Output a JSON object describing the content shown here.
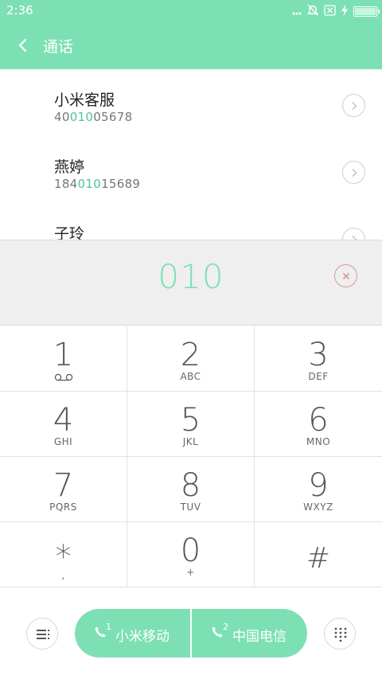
{
  "status_bar": {
    "time": "2:36",
    "icons": [
      "more-dots-icon",
      "mute-bell-icon",
      "sim-off-icon",
      "charging-icon",
      "battery-icon"
    ]
  },
  "app_bar": {
    "title": "通话",
    "back_icon": "chevron-left-icon"
  },
  "contacts": [
    {
      "name": "小米客服",
      "number_pre": "40",
      "number_match": "010",
      "number_post": "05678"
    },
    {
      "name": "燕婷",
      "number_pre": "184",
      "number_match": "010",
      "number_post": "15689"
    },
    {
      "name": "子玲",
      "number_pre": "",
      "number_match": "",
      "number_post": ""
    }
  ],
  "dial_input": {
    "value": "010",
    "clear_icon": "clear-circle-icon"
  },
  "keypad": [
    {
      "digit": "1",
      "letters": ""
    },
    {
      "digit": "2",
      "letters": "ABC"
    },
    {
      "digit": "3",
      "letters": "DEF"
    },
    {
      "digit": "4",
      "letters": "GHI"
    },
    {
      "digit": "5",
      "letters": "JKL"
    },
    {
      "digit": "6",
      "letters": "MNO"
    },
    {
      "digit": "7",
      "letters": "PQRS"
    },
    {
      "digit": "8",
      "letters": "TUV"
    },
    {
      "digit": "9",
      "letters": "WXYZ"
    },
    {
      "digit": "*",
      "letters": ","
    },
    {
      "digit": "0",
      "letters": "+"
    },
    {
      "digit": "#",
      "letters": ""
    }
  ],
  "bottom_bar": {
    "menu_icon": "menu-icon",
    "dialpad_icon": "dialpad-grid-icon",
    "sim1": {
      "index": "1",
      "carrier": "小米移动"
    },
    "sim2": {
      "index": "2",
      "carrier": "中国电信"
    }
  },
  "colors": {
    "accent": "#7de0b5",
    "match_highlight": "#4fc693",
    "clear_button": "#d99a94"
  }
}
